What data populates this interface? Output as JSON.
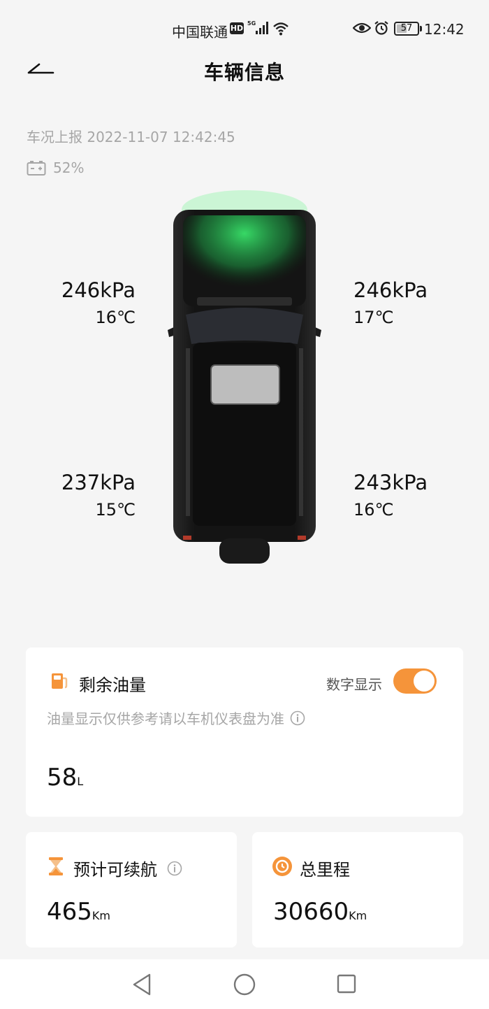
{
  "status_bar": {
    "carrier": "中国联通",
    "hd_badge": "HD",
    "network": "5G",
    "battery": "57",
    "battery_level": 0.57,
    "time": "12:42"
  },
  "header": {
    "title": "车辆信息",
    "back_icon": "back-arrow-icon"
  },
  "report": {
    "label": "车况上报",
    "datetime": "2022-11-07 12:42:45",
    "text": "车况上报 2022-11-07 12:42:45"
  },
  "battery": {
    "icon": "car-battery-icon",
    "percent": "52%"
  },
  "tires": {
    "front_left": {
      "pressure": "246kPa",
      "temp": "16℃"
    },
    "front_right": {
      "pressure": "246kPa",
      "temp": "17℃"
    },
    "rear_left": {
      "pressure": "237kPa",
      "temp": "15℃"
    },
    "rear_right": {
      "pressure": "243kPa",
      "temp": "16℃"
    }
  },
  "fuel": {
    "icon": "fuel-pump-icon",
    "title": "剩余油量",
    "toggle_label": "数字显示",
    "toggle_on": true,
    "note": "油量显示仅供参考请以车机仪表盘为准",
    "value": "58",
    "unit": "L"
  },
  "range": {
    "icon": "hourglass-icon",
    "title": "预计可续航",
    "value": "465",
    "unit": "Km"
  },
  "mileage": {
    "icon": "odometer-icon",
    "title": "总里程",
    "value": "30660",
    "unit": "Km"
  },
  "accent_color": "#f5943a",
  "nav": {
    "back": "triangle-back-icon",
    "home": "circle-home-icon",
    "recent": "square-recent-icon"
  }
}
